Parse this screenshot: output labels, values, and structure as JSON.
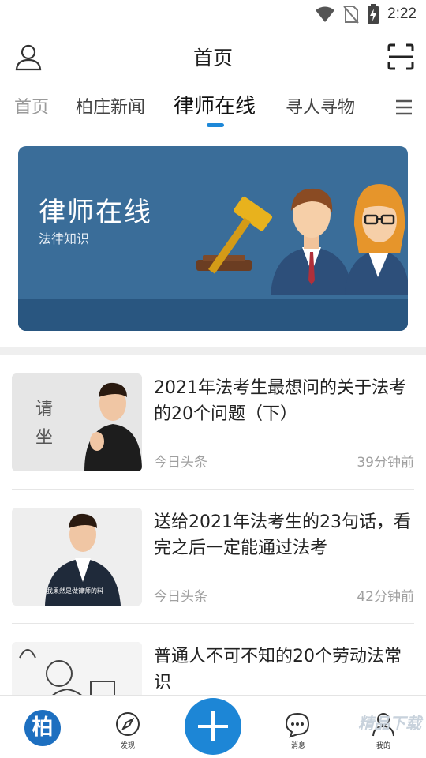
{
  "status_bar": {
    "time": "2:22",
    "icons": [
      "wifi-icon",
      "no-sim-icon",
      "battery-charging-icon"
    ]
  },
  "header": {
    "title": "首页",
    "left_icon": "user-icon",
    "right_icon": "scan-icon"
  },
  "tabs": [
    {
      "label": "首页",
      "active": false
    },
    {
      "label": "柏庄新闻",
      "active": false
    },
    {
      "label": "律师在线",
      "active": true
    },
    {
      "label": "寻人寻物",
      "active": false
    }
  ],
  "banner": {
    "title": "律师在线",
    "subtitle": "法律知识",
    "colors": {
      "background": "#3a6d99",
      "floor": "#295680"
    }
  },
  "news": [
    {
      "title": "2021年法考生最想问的关于法考的20个问题（下）",
      "source": "今日头条",
      "time": "39分钟前",
      "thumb_text": [
        "请",
        "坐"
      ]
    },
    {
      "title": "送给2021年法考生的23句话，看完之后一定能通过法考",
      "source": "今日头条",
      "time": "42分钟前",
      "thumb_caption": "我果然是做律师的料"
    },
    {
      "title": "普通人不可不知的20个劳动法常识",
      "source": "",
      "time": ""
    }
  ],
  "bottom_nav": {
    "items": [
      {
        "label": "",
        "icon": "home-logo-icon",
        "glyph": "柏"
      },
      {
        "label": "发现",
        "icon": "compass-icon"
      },
      {
        "label": "消息",
        "icon": "message-icon"
      },
      {
        "label": "我的",
        "icon": "profile-icon"
      }
    ],
    "fab_icon": "plus-icon",
    "accent_color": "#1d86d6"
  },
  "watermark": "精品下载"
}
